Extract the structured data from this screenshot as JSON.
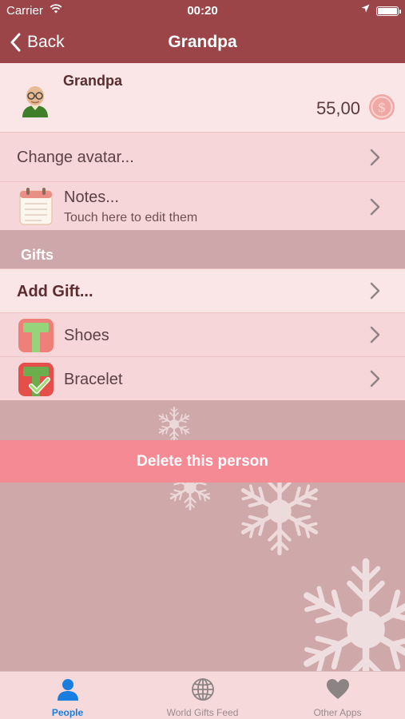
{
  "status_bar": {
    "carrier": "Carrier",
    "time": "00:20"
  },
  "nav": {
    "back_label": "Back",
    "title": "Grandpa"
  },
  "person": {
    "name": "Grandpa",
    "amount": "55,00"
  },
  "rows": {
    "change_avatar": "Change avatar...",
    "notes_title": "Notes...",
    "notes_subtitle": "Touch here to edit them"
  },
  "gifts_section": {
    "header": "Gifts",
    "add_label": "Add Gift...",
    "items": [
      {
        "label": "Shoes",
        "done": false
      },
      {
        "label": "Bracelet",
        "done": true
      }
    ]
  },
  "delete_label": "Delete this person",
  "tabs": [
    {
      "label": "People",
      "icon": "person-icon",
      "active": true
    },
    {
      "label": "World Gifts Feed",
      "icon": "globe-icon",
      "active": false
    },
    {
      "label": "Other Apps",
      "icon": "heart-icon",
      "active": false
    }
  ],
  "colors": {
    "nav_bg": "#9c4548",
    "accent_blue": "#1a7de0",
    "delete_bg": "#f58a94"
  }
}
